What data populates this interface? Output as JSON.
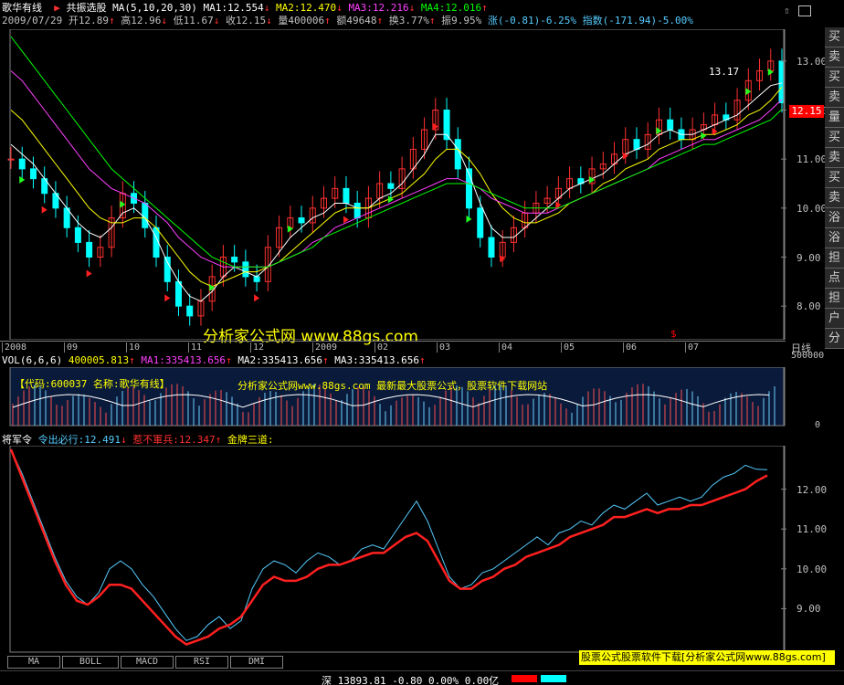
{
  "header": {
    "stock_name": "歌华有线",
    "indicator_name": "共振选股",
    "ma_params": "MA(5,10,20,30)",
    "ma1": "MA1:12.554",
    "ma2": "MA2:12.470",
    "ma3": "MA3:12.216",
    "ma4": "MA4:12.016",
    "date": "2009/07/29",
    "open": "开12.89",
    "high": "高12.96",
    "low": "低11.67",
    "close": "收12.15",
    "volume": "量400006",
    "amount": "额49648",
    "turnover": "换3.77%",
    "amplitude": "振9.95%",
    "change": "涨(-0.81)-6.25%",
    "index": "指数(-171.94)-5.00%"
  },
  "price_axis": {
    "ticks": [
      "13.00",
      "12.00",
      "11.00",
      "10.00",
      "9.00",
      "8.00"
    ],
    "current": "12.15",
    "peak_label": "13.17"
  },
  "time_axis": {
    "labels": [
      "2008",
      "09",
      "10",
      "11",
      "12",
      "2009",
      "02",
      "03",
      "04",
      "05",
      "06",
      "07"
    ],
    "period": "日线"
  },
  "watermark": {
    "main": "分析家公式网 www.88gs.com",
    "vol_info": "【代码:600037 名称:歌华有线】",
    "vol_ad": "分析家公式网www.88gs.com 最新最大股票公式，股票软件下载网站"
  },
  "volume_panel": {
    "params": "VOL(6,6,6)",
    "value": "400005.813",
    "ma1": "MA1:335413.656",
    "ma2": "MA2:335413.656",
    "ma3": "MA3:335413.656",
    "ticks": [
      "500000",
      "0"
    ]
  },
  "indicator_panel": {
    "name": "将军令",
    "line1": "令出必行:12.491",
    "line2": "惹不軍兵:12.347",
    "line3": "金牌三道:",
    "ticks": [
      "12.00",
      "11.00",
      "10.00",
      "9.00"
    ]
  },
  "tabs": [
    "MA",
    "BOLL",
    "MACD",
    "RSI",
    "DMI"
  ],
  "footer": {
    "ad": "股票公式股票软件下载[分析家公式网www.88gs.com]",
    "status": "深 13893.81 -0.80 0.00% 0.00亿"
  },
  "side_tabs": [
    "买",
    "卖",
    "买",
    "卖",
    "量",
    "买",
    "卖",
    "买",
    "卖",
    "浴",
    "浴",
    "担",
    "点",
    "担",
    "户",
    "分"
  ],
  "colors": {
    "up": "#ff3030",
    "down": "#00ffff",
    "ma5": "#ffffff",
    "ma10": "#ffff00",
    "ma20": "#ff40ff",
    "ma30": "#00ff00",
    "fast_line": "#55ccff",
    "slow_line": "#ff2020",
    "price_marker": "#ff0000"
  },
  "chart_data": [
    {
      "type": "line",
      "title": "歌华有线 日线",
      "series": [
        {
          "name": "close",
          "values": [
            11.0,
            10.8,
            10.6,
            10.3,
            10.0,
            9.6,
            9.3,
            9.0,
            9.2,
            9.8,
            10.3,
            10.1,
            9.6,
            9.0,
            8.5,
            8.0,
            7.8,
            8.1,
            8.6,
            9.0,
            8.9,
            8.6,
            8.5,
            9.2,
            9.6,
            9.8,
            9.7,
            10.0,
            10.2,
            10.4,
            10.1,
            9.8,
            10.2,
            10.5,
            10.4,
            10.8,
            11.2,
            11.6,
            12.0,
            11.4,
            10.8,
            10.0,
            9.4,
            9.0,
            9.3,
            9.6,
            9.9,
            10.1,
            10.2,
            10.4,
            10.6,
            10.5,
            10.8,
            10.9,
            11.1,
            11.4,
            11.2,
            11.5,
            11.8,
            11.6,
            11.4,
            11.6,
            11.7,
            11.9,
            11.8,
            12.2,
            12.6,
            12.8,
            13.0,
            12.15
          ]
        },
        {
          "name": "MA1",
          "values": [
            11.3,
            11.1,
            10.9,
            10.6,
            10.3,
            10.0,
            9.7,
            9.5,
            9.4,
            9.6,
            9.9,
            10.0,
            9.8,
            9.4,
            8.9,
            8.5,
            8.2,
            8.1,
            8.3,
            8.6,
            8.8,
            8.7,
            8.6,
            8.8,
            9.1,
            9.4,
            9.6,
            9.8,
            9.9,
            10.1,
            10.1,
            10.0,
            10.0,
            10.2,
            10.3,
            10.5,
            10.8,
            11.1,
            11.5,
            11.5,
            11.2,
            10.7,
            10.1,
            9.6,
            9.4,
            9.4,
            9.6,
            9.8,
            10.0,
            10.2,
            10.4,
            10.5,
            10.6,
            10.7,
            10.9,
            11.1,
            11.2,
            11.3,
            11.5,
            11.6,
            11.5,
            11.5,
            11.6,
            11.7,
            11.8,
            11.9,
            12.1,
            12.3,
            12.5,
            12.554
          ]
        },
        {
          "name": "MA2",
          "values": [
            12.0,
            11.8,
            11.5,
            11.2,
            10.9,
            10.6,
            10.3,
            10.0,
            9.8,
            9.7,
            9.7,
            9.8,
            9.8,
            9.6,
            9.3,
            9.0,
            8.7,
            8.5,
            8.4,
            8.5,
            8.6,
            8.7,
            8.7,
            8.8,
            8.9,
            9.1,
            9.3,
            9.5,
            9.7,
            9.9,
            10.0,
            10.0,
            10.0,
            10.1,
            10.2,
            10.3,
            10.5,
            10.7,
            11.0,
            11.2,
            11.2,
            11.0,
            10.7,
            10.3,
            10.0,
            9.8,
            9.7,
            9.7,
            9.8,
            9.9,
            10.1,
            10.2,
            10.3,
            10.5,
            10.6,
            10.8,
            10.9,
            11.0,
            11.2,
            11.3,
            11.4,
            11.4,
            11.5,
            11.5,
            11.6,
            11.7,
            11.9,
            12.0,
            12.2,
            12.47
          ]
        },
        {
          "name": "MA3",
          "values": [
            12.8,
            12.6,
            12.3,
            12.0,
            11.7,
            11.4,
            11.1,
            10.8,
            10.6,
            10.4,
            10.3,
            10.2,
            10.1,
            9.9,
            9.7,
            9.4,
            9.2,
            9.0,
            8.9,
            8.8,
            8.8,
            8.8,
            8.8,
            8.8,
            8.9,
            9.0,
            9.1,
            9.3,
            9.4,
            9.6,
            9.7,
            9.8,
            9.9,
            10.0,
            10.1,
            10.2,
            10.3,
            10.4,
            10.5,
            10.6,
            10.6,
            10.5,
            10.4,
            10.2,
            10.1,
            10.0,
            9.9,
            9.9,
            9.9,
            10.0,
            10.1,
            10.2,
            10.3,
            10.4,
            10.5,
            10.6,
            10.7,
            10.8,
            11.0,
            11.1,
            11.2,
            11.3,
            11.4,
            11.4,
            11.5,
            11.6,
            11.7,
            11.8,
            12.0,
            12.216
          ]
        },
        {
          "name": "MA4",
          "values": [
            13.5,
            13.2,
            12.9,
            12.6,
            12.3,
            12.0,
            11.7,
            11.4,
            11.1,
            10.8,
            10.6,
            10.4,
            10.2,
            10.0,
            9.8,
            9.6,
            9.4,
            9.2,
            9.0,
            8.9,
            8.8,
            8.8,
            8.8,
            8.8,
            8.9,
            9.0,
            9.1,
            9.2,
            9.4,
            9.5,
            9.6,
            9.7,
            9.8,
            9.9,
            10.0,
            10.1,
            10.2,
            10.3,
            10.4,
            10.5,
            10.5,
            10.5,
            10.4,
            10.3,
            10.2,
            10.1,
            10.0,
            10.0,
            10.0,
            10.0,
            10.1,
            10.2,
            10.3,
            10.4,
            10.5,
            10.6,
            10.7,
            10.8,
            10.9,
            11.0,
            11.1,
            11.2,
            11.3,
            11.3,
            11.4,
            11.5,
            11.6,
            11.7,
            11.8,
            12.016
          ]
        }
      ],
      "ylim": [
        7.5,
        13.5
      ]
    },
    {
      "type": "line",
      "title": "将军令",
      "series": [
        {
          "name": "令出必行",
          "values": [
            13.0,
            12.4,
            11.7,
            11.0,
            10.3,
            9.7,
            9.3,
            9.1,
            9.4,
            10.0,
            10.2,
            10.0,
            9.6,
            9.3,
            8.9,
            8.5,
            8.2,
            8.3,
            8.6,
            8.8,
            8.5,
            8.7,
            9.5,
            10.0,
            10.2,
            10.1,
            9.9,
            10.2,
            10.4,
            10.3,
            10.1,
            10.2,
            10.5,
            10.6,
            10.5,
            10.9,
            11.3,
            11.7,
            11.2,
            10.5,
            9.8,
            9.5,
            9.6,
            9.9,
            10.0,
            10.2,
            10.4,
            10.6,
            10.8,
            10.6,
            10.9,
            11.0,
            11.2,
            11.1,
            11.4,
            11.6,
            11.5,
            11.7,
            11.9,
            11.6,
            11.7,
            11.8,
            11.7,
            11.8,
            12.1,
            12.3,
            12.4,
            12.6,
            12.5,
            12.491
          ]
        },
        {
          "name": "惹不軍兵",
          "values": [
            13.0,
            12.3,
            11.6,
            10.9,
            10.2,
            9.6,
            9.2,
            9.1,
            9.3,
            9.6,
            9.6,
            9.5,
            9.2,
            8.9,
            8.6,
            8.3,
            8.1,
            8.2,
            8.3,
            8.5,
            8.6,
            8.8,
            9.2,
            9.6,
            9.8,
            9.7,
            9.7,
            9.8,
            10.0,
            10.1,
            10.1,
            10.2,
            10.3,
            10.4,
            10.4,
            10.6,
            10.8,
            10.9,
            10.7,
            10.2,
            9.7,
            9.5,
            9.5,
            9.7,
            9.8,
            10.0,
            10.1,
            10.3,
            10.4,
            10.5,
            10.6,
            10.8,
            10.9,
            11.0,
            11.1,
            11.3,
            11.3,
            11.4,
            11.5,
            11.4,
            11.5,
            11.5,
            11.6,
            11.6,
            11.7,
            11.8,
            11.9,
            12.0,
            12.2,
            12.347
          ]
        }
      ],
      "ylim": [
        8.0,
        13.0
      ]
    }
  ]
}
